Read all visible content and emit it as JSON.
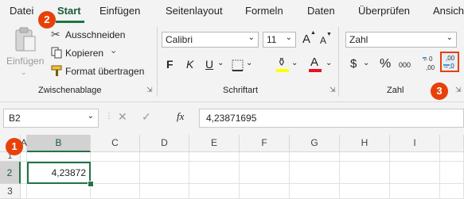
{
  "tabs": [
    "Datei",
    "Start",
    "Einfügen",
    "Seitenlayout",
    "Formeln",
    "Daten",
    "Überprüfen",
    "Ansich"
  ],
  "clipboard": {
    "paste_label": "Einfügen",
    "cut_label": "Ausschneiden",
    "copy_label": "Kopieren",
    "format_painter_label": "Format übertragen",
    "group_label": "Zwischenablage"
  },
  "font": {
    "font_name": "Calibri",
    "font_size": "11",
    "bold": "F",
    "italic": "K",
    "underline": "U",
    "font_color_glyph": "A",
    "grow_glyph": "A",
    "shrink_glyph": "A",
    "group_label": "Schriftart"
  },
  "number": {
    "format": "Zahl",
    "currency_glyph": "$",
    "percent_glyph": "%",
    "thousands_glyph": "000",
    "group_label": "Zahl"
  },
  "badges": [
    "1",
    "2",
    "3"
  ],
  "formula_bar": {
    "name_box": "B2",
    "fx": "fx",
    "value": "4,23871695"
  },
  "grid": {
    "columns": [
      "A",
      "B",
      "C",
      "D",
      "E",
      "F",
      "G",
      "H",
      "I"
    ],
    "rows": [
      "1",
      "2",
      "3"
    ],
    "selected_cell_value": "4,23872"
  },
  "colors": {
    "accent": "#217346",
    "badge": "#e8400a",
    "highlight": "#ffff00",
    "font_red": "#e81123",
    "annotation_box": "#e8400a"
  }
}
